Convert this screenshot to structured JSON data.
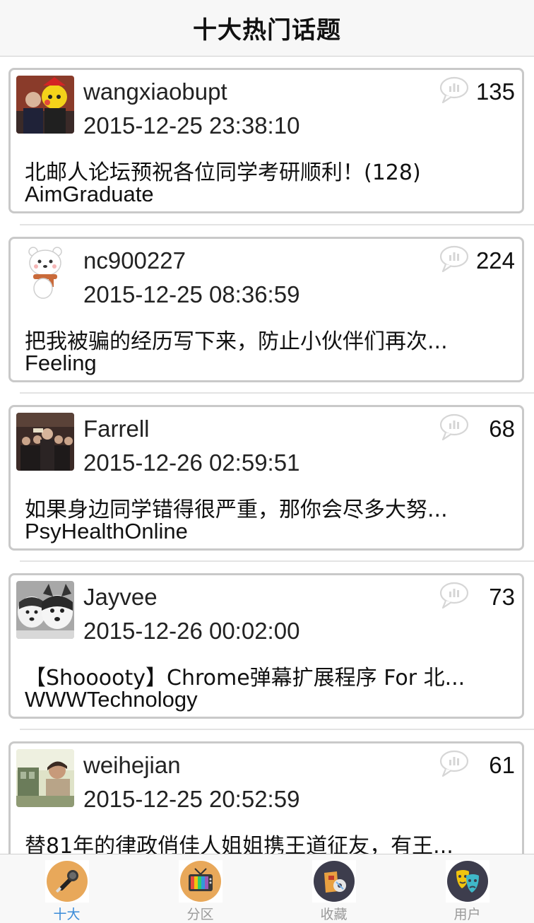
{
  "navbar": {
    "title": "十大热门话题"
  },
  "posts": [
    {
      "author": "wangxiaobupt",
      "time": "2015-12-25 23:38:10",
      "topic": "北邮人论坛预祝各位同学考研顺利！(128)",
      "board": "AimGraduate",
      "replies": "135",
      "avatar_icon": "photo-avatar-icon"
    },
    {
      "author": "nc900227",
      "time": "2015-12-25 08:36:59",
      "topic": "把我被骗的经历写下来，防止小伙伴们再次...",
      "board": "Feeling",
      "replies": "224",
      "avatar_icon": "bear-avatar-icon"
    },
    {
      "author": "Farrell",
      "time": "2015-12-26 02:59:51",
      "topic": "如果身边同学错得很严重，那你会尽多大努...",
      "board": "PsyHealthOnline",
      "replies": "68",
      "avatar_icon": "photo-avatar-icon"
    },
    {
      "author": "Jayvee",
      "time": "2015-12-26 00:02:00",
      "topic": "【Shooooty】Chrome弹幕扩展程序 For 北...",
      "board": "WWWTechnology",
      "replies": "73",
      "avatar_icon": "husky-avatar-icon"
    },
    {
      "author": "weihejian",
      "time": "2015-12-25 20:52:59",
      "topic": "替81年的律政俏佳人姐姐携王道征友，有王...",
      "board": "",
      "replies": "61",
      "avatar_icon": "photo-avatar-icon"
    }
  ],
  "tabbar": {
    "items": [
      {
        "label": "十大",
        "icon": "microphone-icon",
        "active": true
      },
      {
        "label": "分区",
        "icon": "tv-icon",
        "active": false
      },
      {
        "label": "收藏",
        "icon": "bookmark-icon",
        "active": false
      },
      {
        "label": "用户",
        "icon": "mask-icon",
        "active": false
      }
    ]
  },
  "colors": {
    "active_tab": "#3a8bd8",
    "inactive_tab": "#9a9a9a",
    "card_border": "#c9c9c9"
  }
}
